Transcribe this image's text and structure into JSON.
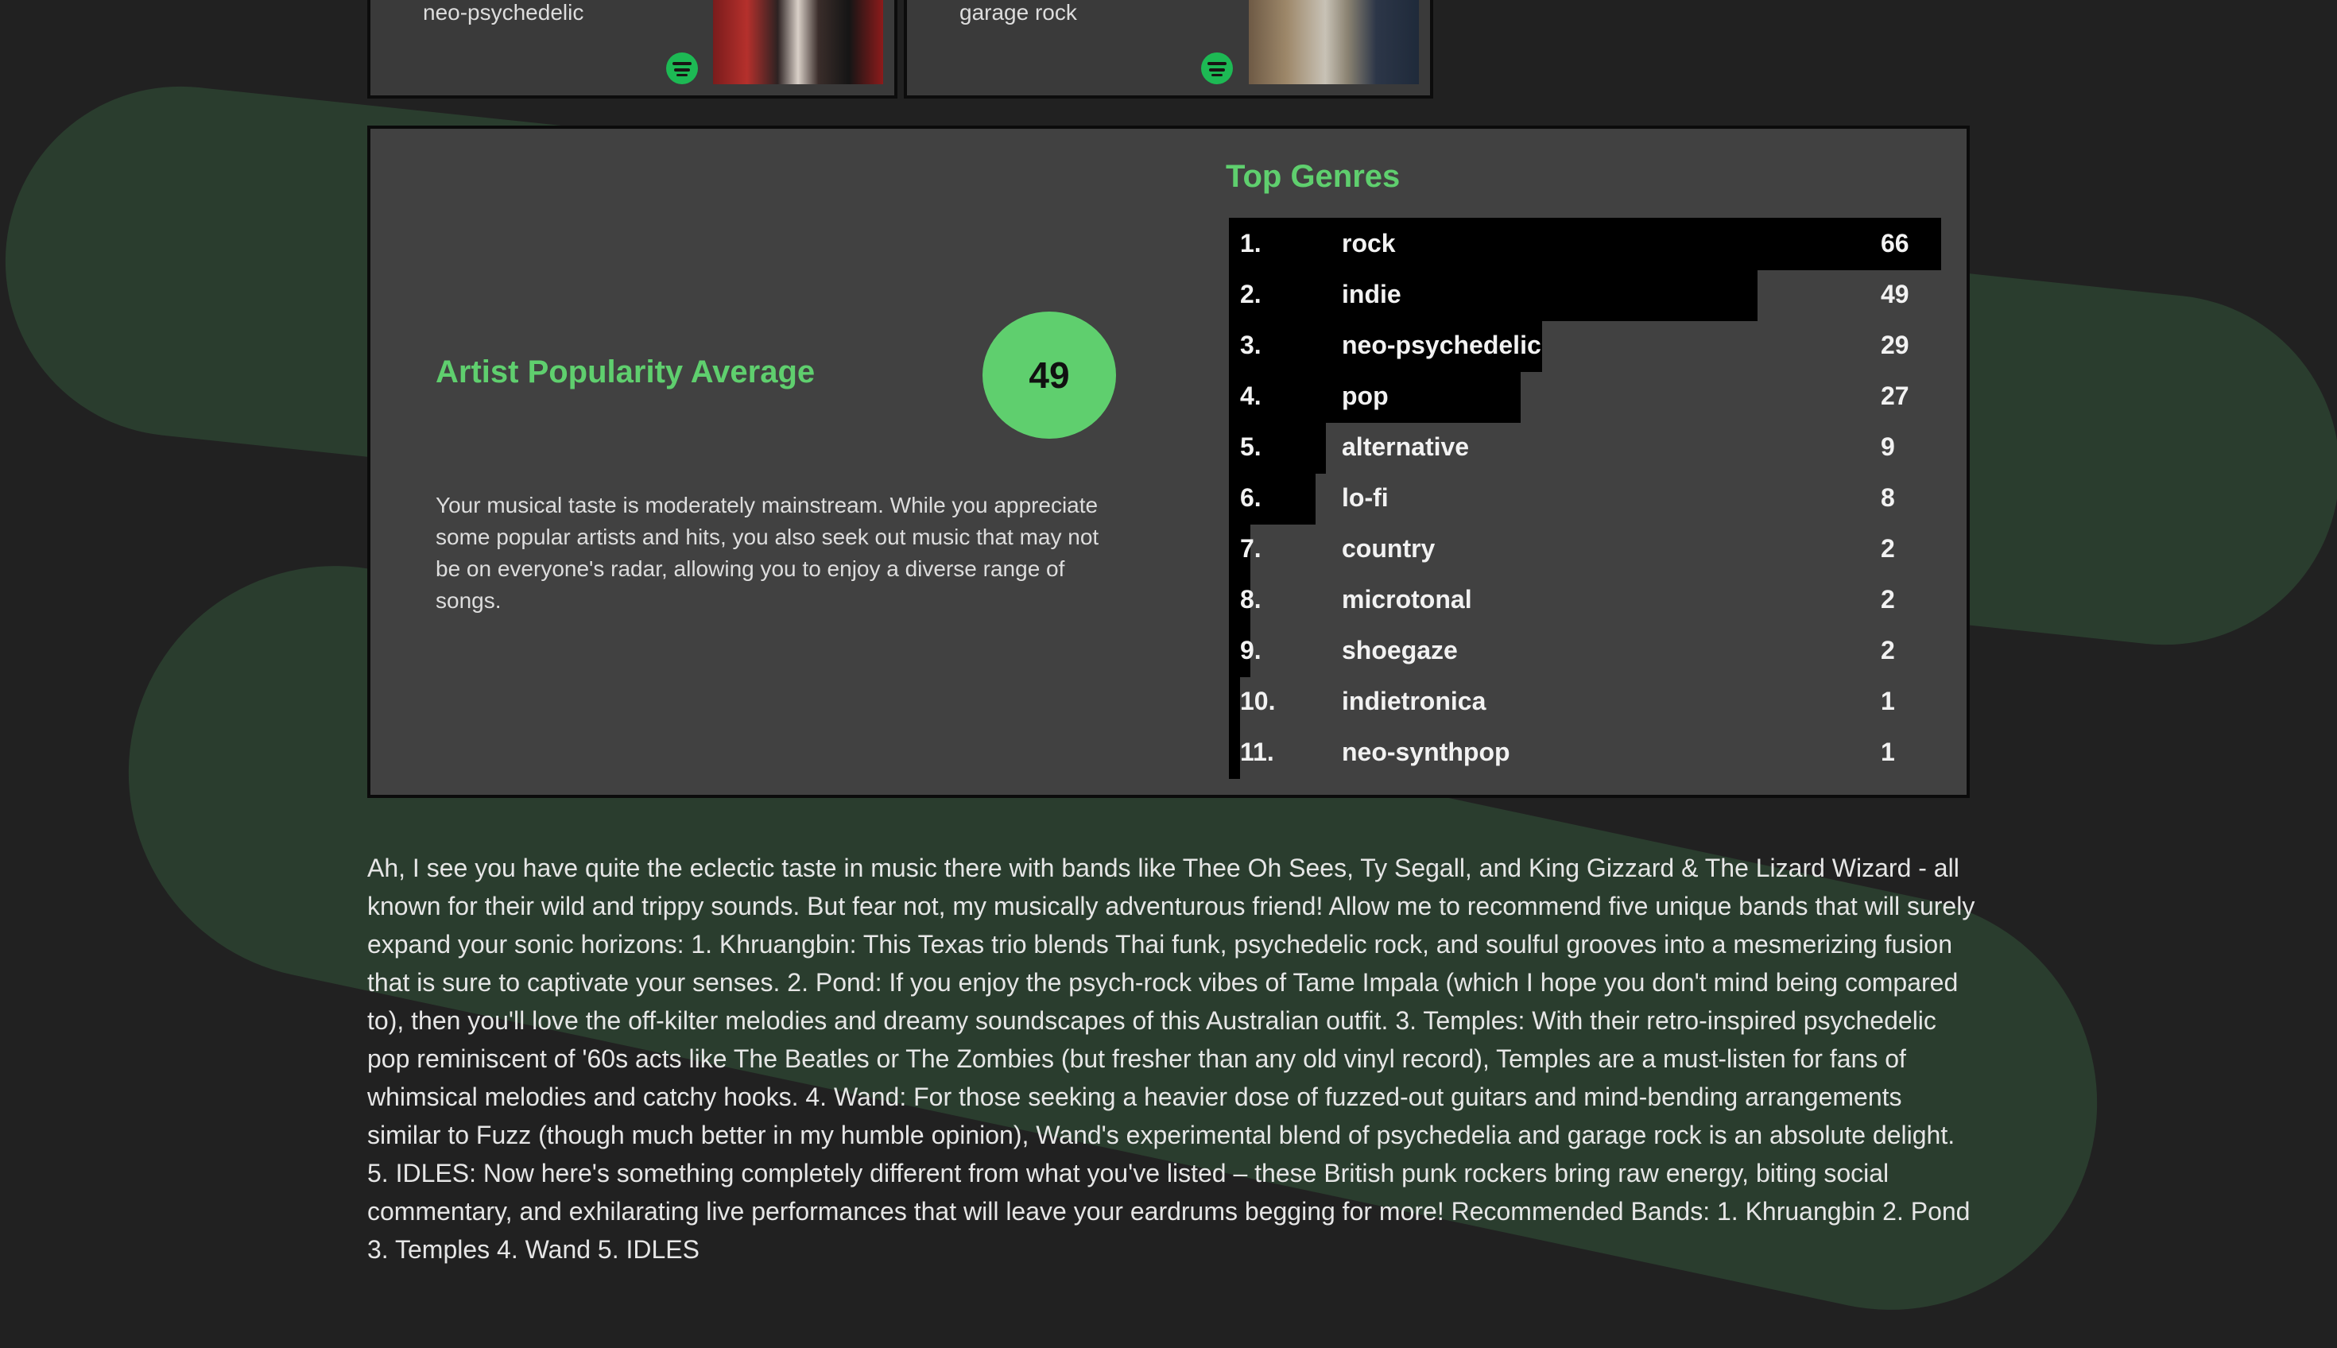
{
  "cards": [
    {
      "genre": "neo-psychedelic",
      "icon": "spotify-icon"
    },
    {
      "genre": "garage rock",
      "icon": "spotify-icon"
    }
  ],
  "popularity": {
    "title": "Artist Popularity Average",
    "value": "49",
    "description": "Your musical taste is moderately mainstream. While you appreciate some popular artists and hits, you also seek out music that may not be on everyone's radar, allowing you to enjoy a diverse range of songs."
  },
  "top_genres": {
    "title": "Top Genres",
    "items": [
      {
        "rank": "1.",
        "name": "rock",
        "count": 66
      },
      {
        "rank": "2.",
        "name": "indie",
        "count": 49
      },
      {
        "rank": "3.",
        "name": "neo-psychedelic",
        "count": 29
      },
      {
        "rank": "4.",
        "name": "pop",
        "count": 27
      },
      {
        "rank": "5.",
        "name": "alternative",
        "count": 9
      },
      {
        "rank": "6.",
        "name": "lo-fi",
        "count": 8
      },
      {
        "rank": "7.",
        "name": "country",
        "count": 2
      },
      {
        "rank": "8.",
        "name": "microtonal",
        "count": 2
      },
      {
        "rank": "9.",
        "name": "shoegaze",
        "count": 2
      },
      {
        "rank": "10.",
        "name": "indietronica",
        "count": 1
      },
      {
        "rank": "11.",
        "name": "neo-synthpop",
        "count": 1
      }
    ]
  },
  "recommendation": {
    "text": "Ah, I see you have quite the eclectic taste in music there with bands like Thee Oh Sees, Ty Segall, and King Gizzard & The Lizard Wizard - all known for their wild and trippy sounds. But fear not, my musically adventurous friend! Allow me to recommend five unique bands that will surely expand your sonic horizons: 1. Khruangbin: This Texas trio blends Thai funk, psychedelic rock, and soulful grooves into a mesmerizing fusion that is sure to captivate your senses. 2. Pond: If you enjoy the psych-rock vibes of Tame Impala (which I hope you don't mind being compared to), then you'll love the off-kilter melodies and dreamy soundscapes of this Australian outfit. 3. Temples: With their retro-inspired psychedelic pop reminiscent of '60s acts like The Beatles or The Zombies (but fresher than any old vinyl record), Temples are a must-listen for fans of whimsical melodies and catchy hooks. 4. Wand: For those seeking a heavier dose of fuzzed-out guitars and mind-bending arrangements similar to Fuzz (though much better in my humble opinion), Wand's experimental blend of psychedelia and garage rock is an absolute delight. 5. IDLES: Now here's something completely different from what you've listed – these British punk rockers bring raw energy, biting social commentary, and exhilarating live performances that will leave your eardrums begging for more! Recommended Bands: 1. Khruangbin 2. Pond 3. Temples 4. Wand 5. IDLES"
  },
  "colors": {
    "accent": "#5fcf6e",
    "background": "#212121",
    "panel": "#414141",
    "blob": "#2a3d2e",
    "spotify": "#1db954"
  }
}
